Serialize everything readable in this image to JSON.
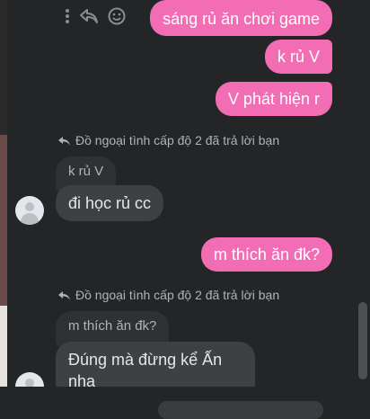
{
  "messages_out": [
    {
      "text": "sáng rủ ăn chơi game"
    },
    {
      "text": "k rủ V"
    },
    {
      "text": "V phát hiện r"
    },
    {
      "text": "m thích ăn đk?"
    }
  ],
  "reply1": {
    "note": "Đồ ngoại tình cấp độ 2 đã trả lời bạn",
    "quoted": "k rủ V",
    "message": "đi học rủ cc"
  },
  "reply2": {
    "note": "Đồ ngoại tình cấp độ 2 đã trả lời bạn",
    "quoted": "m thích ăn đk?",
    "message": "Đúng mà đừng kể Ấn nha"
  },
  "icons": [
    "more-icon",
    "reply-icon",
    "emoji-icon",
    "reply-arrow-icon",
    "avatar-icon"
  ],
  "colors": {
    "background": "#242526",
    "outgoing": "#f26db4",
    "incoming": "#3e4042"
  }
}
